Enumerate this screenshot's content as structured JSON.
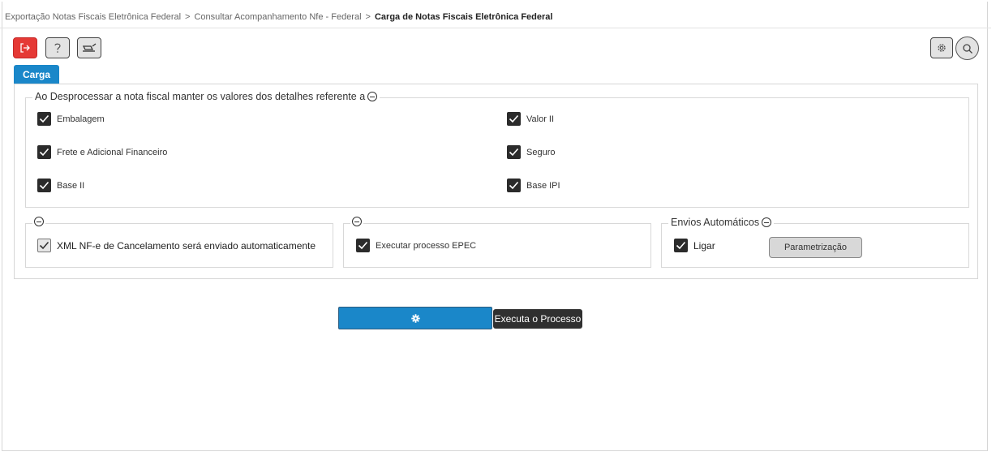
{
  "breadcrumb": {
    "items": [
      "Exportação Notas Fiscais Eletrônica Federal",
      "Consultar Acompanhamento Nfe - Federal"
    ],
    "current": "Carga de Notas Fiscais Eletrônica Federal",
    "separator": ">"
  },
  "toolbar": {
    "exit_icon": "exit-icon",
    "help_icon": "help-icon",
    "erase_icon": "eraser-icon",
    "settings_icon": "gear-icon",
    "search_icon": "search-icon",
    "exit_color": "#e53935"
  },
  "tabs": [
    {
      "label": "Carga",
      "active": true
    }
  ],
  "accent_color": "#1a87c9",
  "details_group": {
    "legend": "Ao Desprocessar a nota fiscal manter os valores dos detalhes referente a",
    "left": [
      {
        "label": "Embalagem",
        "checked": true
      },
      {
        "label": "Frete e Adicional Financeiro",
        "checked": true
      },
      {
        "label": "Base II",
        "checked": true
      }
    ],
    "right": [
      {
        "label": "Valor II",
        "checked": true
      },
      {
        "label": "Seguro",
        "checked": true
      },
      {
        "label": "Base IPI",
        "checked": true
      }
    ]
  },
  "cancel_group": {
    "legend": "",
    "checkbox": {
      "label": "XML NF-e de Cancelamento será enviado automaticamente",
      "checked": true
    }
  },
  "epec_group": {
    "legend": "",
    "checkbox": {
      "label": "Executar processo EPEC",
      "checked": true
    }
  },
  "auto_group": {
    "legend": "Envios Automáticos",
    "checkbox": {
      "label": "Ligar",
      "checked": true
    },
    "button_label": "Parametrização"
  },
  "execute": {
    "icon": "gear-icon",
    "tooltip": "Executa o Processo"
  }
}
